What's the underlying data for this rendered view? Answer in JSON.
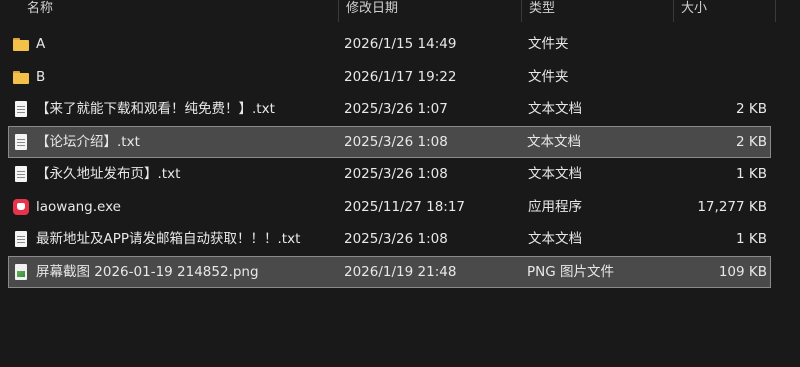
{
  "columns": {
    "name": "名称",
    "date": "修改日期",
    "type": "类型",
    "size": "大小"
  },
  "files": [
    {
      "icon": "folder-icon",
      "name": "A",
      "date": "2026/1/15 14:49",
      "type": "文件夹",
      "size": ""
    },
    {
      "icon": "folder-icon",
      "name": "B",
      "date": "2026/1/17 19:22",
      "type": "文件夹",
      "size": ""
    },
    {
      "icon": "text-file-icon",
      "name": "【来了就能下载和观看！纯免费！】.txt",
      "date": "2025/3/26 1:07",
      "type": "文本文档",
      "size": "2 KB"
    },
    {
      "icon": "text-file-icon",
      "name": "【论坛介绍】.txt",
      "date": "2025/3/26 1:08",
      "type": "文本文档",
      "size": "2 KB"
    },
    {
      "icon": "text-file-icon",
      "name": "【永久地址发布页】.txt",
      "date": "2025/3/26 1:08",
      "type": "文本文档",
      "size": "1 KB"
    },
    {
      "icon": "app-icon",
      "name": "laowang.exe",
      "date": "2025/11/27 18:17",
      "type": "应用程序",
      "size": "17,277 KB"
    },
    {
      "icon": "text-file-icon",
      "name": "最新地址及APP请发邮箱自动获取！！！.txt",
      "date": "2025/3/26 1:08",
      "type": "文本文档",
      "size": "1 KB"
    },
    {
      "icon": "image-file-icon",
      "name": "屏幕截图 2026-01-19 214852.png",
      "date": "2026/1/19 21:48",
      "type": "PNG 图片文件",
      "size": "109 KB"
    }
  ]
}
